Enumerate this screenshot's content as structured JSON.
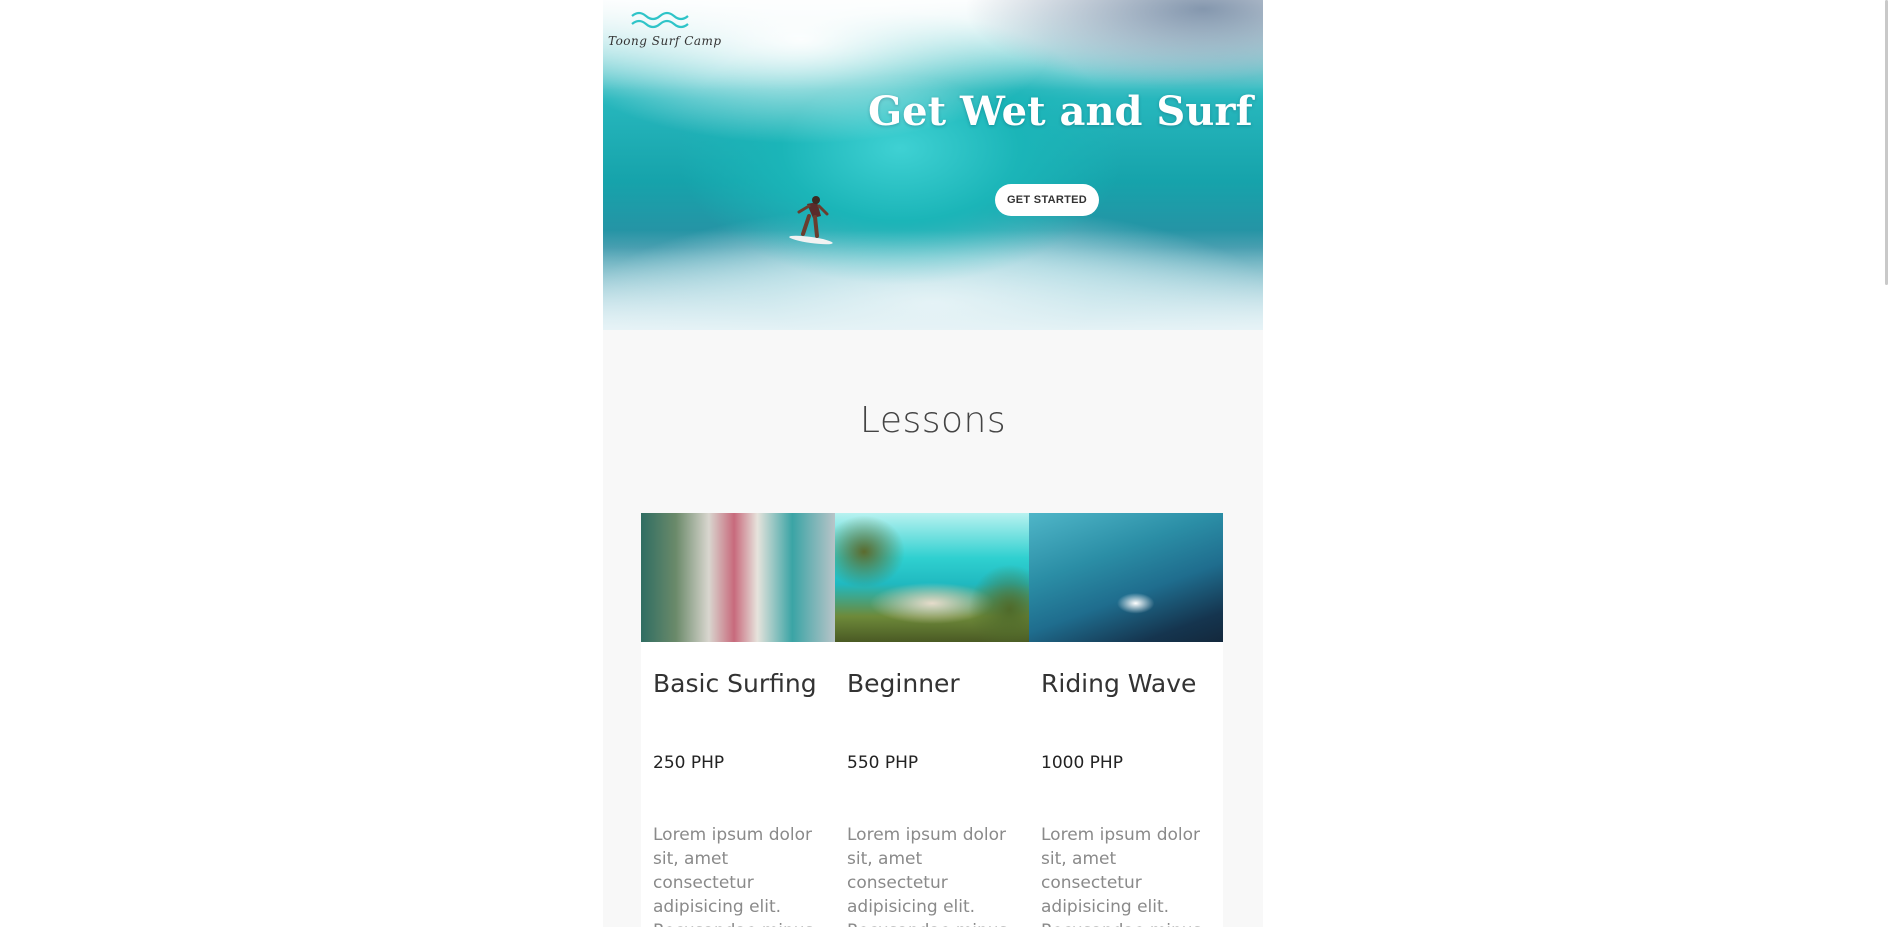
{
  "brand": {
    "name": "Toong Surf Camp",
    "logo_icon": "wave-logo-icon",
    "accent": "#2ec4c8"
  },
  "hero": {
    "title": "Get Wet and Surf",
    "cta_label": "GET STARTED"
  },
  "lessons": {
    "title": "Lessons",
    "cards": [
      {
        "title": "Basic Surfing",
        "price": "250 PHP",
        "description": "Lorem ipsum dolor sit, amet consectetur adipisicing elit. Recusandae minus"
      },
      {
        "title": "Beginner",
        "price": "550 PHP",
        "description": "Lorem ipsum dolor sit, amet consectetur adipisicing elit. Recusandae minus"
      },
      {
        "title": "Riding Wave",
        "price": "1000 PHP",
        "description": "Lorem ipsum dolor sit, amet consectetur adipisicing elit. Recusandae minus"
      }
    ]
  }
}
